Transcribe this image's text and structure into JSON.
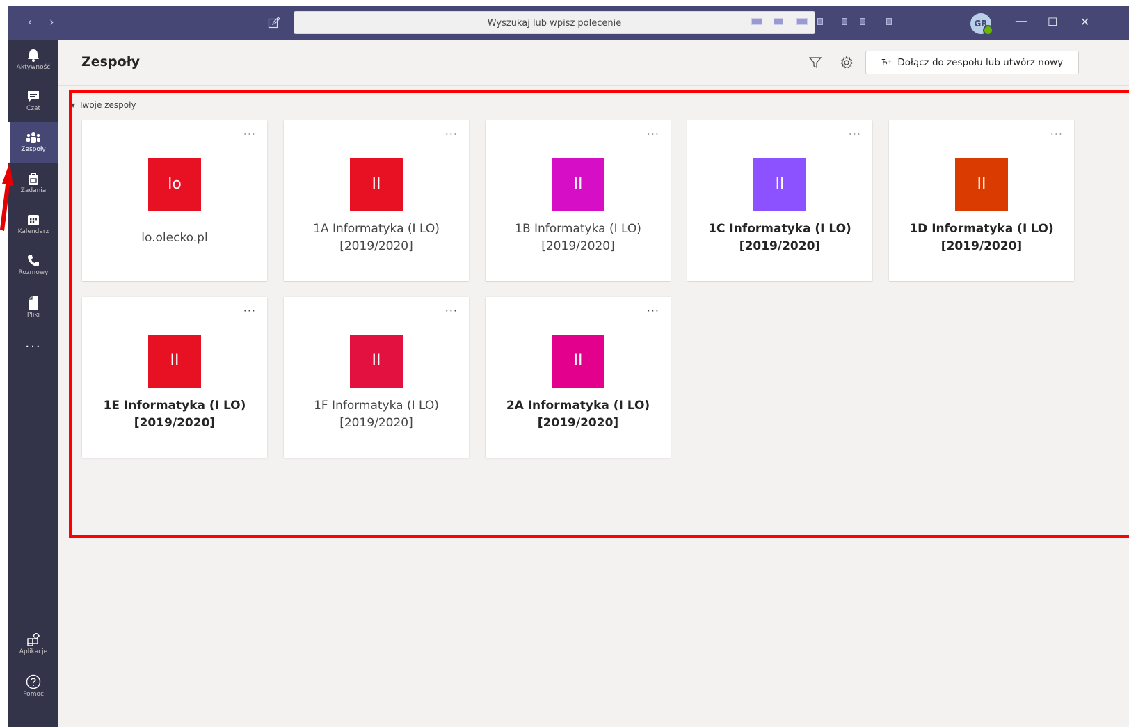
{
  "titlebar": {
    "back_label": "‹",
    "forward_label": "›",
    "search_placeholder": "Wyszukaj lub wpisz polecenie",
    "avatar_initials": "GR",
    "minimize_label": "—",
    "maximize_label": "☐",
    "close_label": "✕"
  },
  "rail": {
    "items": [
      {
        "label": "Aktywność",
        "icon": "bell-icon"
      },
      {
        "label": "Czat",
        "icon": "chat-icon"
      },
      {
        "label": "Zespoły",
        "icon": "teams-icon"
      },
      {
        "label": "Zadania",
        "icon": "assignments-icon"
      },
      {
        "label": "Kalendarz",
        "icon": "calendar-icon"
      },
      {
        "label": "Rozmowy",
        "icon": "phone-icon"
      },
      {
        "label": "Pliki",
        "icon": "files-icon"
      }
    ],
    "more_label": "...",
    "apps_label": "Aplikacje",
    "help_label": "Pomoc"
  },
  "header": {
    "title": "Zespoły",
    "join_button_label": "Dołącz do zespołu lub utwórz nowy"
  },
  "section": {
    "label": "Twoje zespoły"
  },
  "teams": [
    {
      "initials": "lo",
      "name": "lo.olecko.pl",
      "color": "#e81123",
      "bold": false
    },
    {
      "initials": "II",
      "name": "1A Informatyka (I LO)\n[2019/2020]",
      "color": "#e81123",
      "bold": false
    },
    {
      "initials": "II",
      "name": "1B Informatyka (I LO)\n[2019/2020]",
      "color": "#d60fc6",
      "bold": false
    },
    {
      "initials": "II",
      "name": "1C Informatyka (I LO)\n[2019/2020]",
      "color": "#8c52ff",
      "bold": true
    },
    {
      "initials": "II",
      "name": "1D Informatyka (I LO)\n[2019/2020]",
      "color": "#da3b01",
      "bold": true
    },
    {
      "initials": "II",
      "name": "1E Informatyka (I LO)\n[2019/2020]",
      "color": "#e81123",
      "bold": true
    },
    {
      "initials": "II",
      "name": "1F Informatyka (I LO)\n[2019/2020]",
      "color": "#e3113f",
      "bold": false
    },
    {
      "initials": "II",
      "name": "2A Informatyka (I LO)\n[2019/2020]",
      "color": "#e3008c",
      "bold": true
    }
  ],
  "card_more_label": "···"
}
